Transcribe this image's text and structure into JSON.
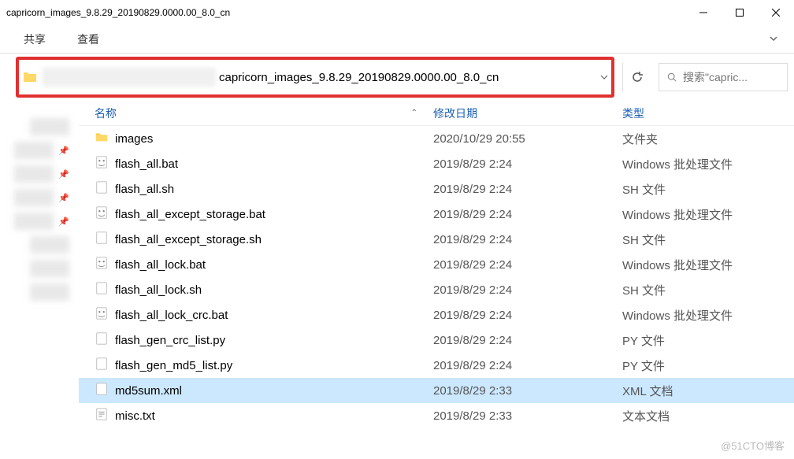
{
  "window": {
    "title": "capricorn_images_9.8.29_20190829.0000.00_8.0_cn"
  },
  "ribbon": {
    "tabs": [
      "共享",
      "查看"
    ]
  },
  "address": {
    "path": "capricorn_images_9.8.29_20190829.0000.00_8.0_cn"
  },
  "search": {
    "placeholder": "搜索\"capric..."
  },
  "columns": {
    "name": "名称",
    "date": "修改日期",
    "type": "类型"
  },
  "files": [
    {
      "icon": "folder",
      "name": "images",
      "date": "2020/10/29 20:55",
      "type": "文件夹",
      "selected": false
    },
    {
      "icon": "bat",
      "name": "flash_all.bat",
      "date": "2019/8/29 2:24",
      "type": "Windows 批处理文件",
      "selected": false
    },
    {
      "icon": "doc",
      "name": "flash_all.sh",
      "date": "2019/8/29 2:24",
      "type": "SH 文件",
      "selected": false
    },
    {
      "icon": "bat",
      "name": "flash_all_except_storage.bat",
      "date": "2019/8/29 2:24",
      "type": "Windows 批处理文件",
      "selected": false
    },
    {
      "icon": "doc",
      "name": "flash_all_except_storage.sh",
      "date": "2019/8/29 2:24",
      "type": "SH 文件",
      "selected": false
    },
    {
      "icon": "bat",
      "name": "flash_all_lock.bat",
      "date": "2019/8/29 2:24",
      "type": "Windows 批处理文件",
      "selected": false
    },
    {
      "icon": "doc",
      "name": "flash_all_lock.sh",
      "date": "2019/8/29 2:24",
      "type": "SH 文件",
      "selected": false
    },
    {
      "icon": "bat",
      "name": "flash_all_lock_crc.bat",
      "date": "2019/8/29 2:24",
      "type": "Windows 批处理文件",
      "selected": false
    },
    {
      "icon": "doc",
      "name": "flash_gen_crc_list.py",
      "date": "2019/8/29 2:24",
      "type": "PY 文件",
      "selected": false
    },
    {
      "icon": "doc",
      "name": "flash_gen_md5_list.py",
      "date": "2019/8/29 2:24",
      "type": "PY 文件",
      "selected": false
    },
    {
      "icon": "doc",
      "name": "md5sum.xml",
      "date": "2019/8/29 2:33",
      "type": "XML 文档",
      "selected": true
    },
    {
      "icon": "txt",
      "name": "misc.txt",
      "date": "2019/8/29 2:33",
      "type": "文本文档",
      "selected": false
    }
  ],
  "watermark": "@51CTO博客"
}
